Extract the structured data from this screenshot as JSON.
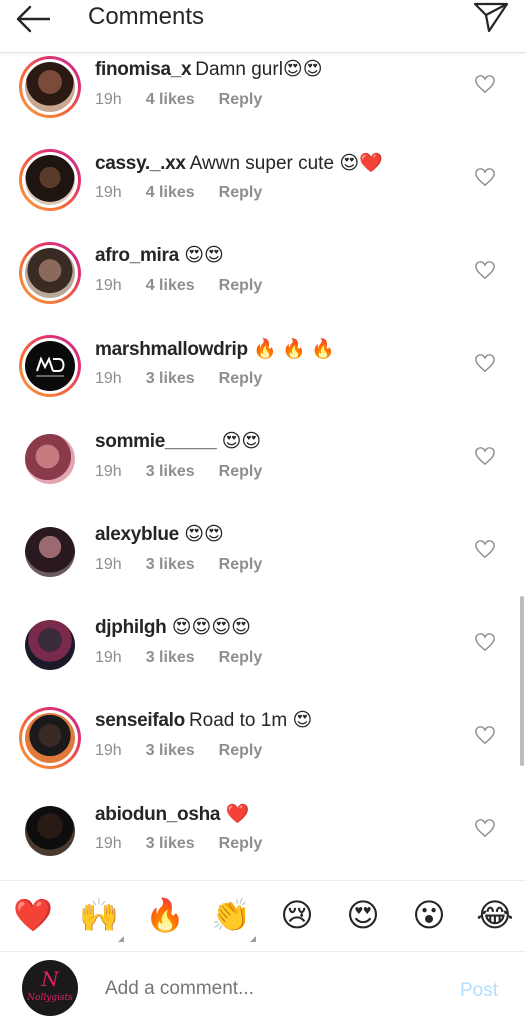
{
  "header": {
    "title": "Comments"
  },
  "comments": [
    {
      "username": "finomisa_x",
      "text": "Damn gurl",
      "emoji": "😍😍",
      "time": "19h",
      "likes": "4 likes",
      "reply": "Reply",
      "ring": "story"
    },
    {
      "username": "cassy._.xx",
      "text": "Awwn super cute",
      "emoji": "😍❤️",
      "time": "19h",
      "likes": "4 likes",
      "reply": "Reply",
      "ring": "story"
    },
    {
      "username": "afro_mira",
      "text": "",
      "emoji": "😍😍",
      "time": "19h",
      "likes": "4 likes",
      "reply": "Reply",
      "ring": "story"
    },
    {
      "username": "marshmallowdrip",
      "text": "",
      "emoji": "🔥 🔥 🔥",
      "time": "19h",
      "likes": "3 likes",
      "reply": "Reply",
      "ring": "story"
    },
    {
      "username": "sommie_____",
      "text": "",
      "emoji": "😍😍",
      "time": "19h",
      "likes": "3 likes",
      "reply": "Reply",
      "ring": "plain"
    },
    {
      "username": "alexyblue",
      "text": "",
      "emoji": "😍😍",
      "time": "19h",
      "likes": "3 likes",
      "reply": "Reply",
      "ring": "plain"
    },
    {
      "username": "djphilgh",
      "text": "",
      "emoji": "😍😍😍😍",
      "time": "19h",
      "likes": "3 likes",
      "reply": "Reply",
      "ring": "plain"
    },
    {
      "username": "senseifalo",
      "text": "Road to 1m",
      "emoji": "😍",
      "time": "19h",
      "likes": "3 likes",
      "reply": "Reply",
      "ring": "story"
    },
    {
      "username": "abiodun_osha",
      "text": "",
      "emoji": "❤️",
      "time": "19h",
      "likes": "3 likes",
      "reply": "Reply",
      "ring": "plain"
    }
  ],
  "quick_reactions": [
    "❤️",
    "🙌",
    "🔥",
    "👏",
    "😢",
    "😍",
    "😮",
    "😂"
  ],
  "composer": {
    "placeholder": "Add a comment...",
    "post_label": "Post",
    "avatar_text": "Nollygists"
  },
  "colors": {
    "accent": "#b2dffc",
    "story_ring_start": "#f9a03c",
    "story_ring_end": "#c22b9a",
    "heart_red": "#e0203a"
  }
}
